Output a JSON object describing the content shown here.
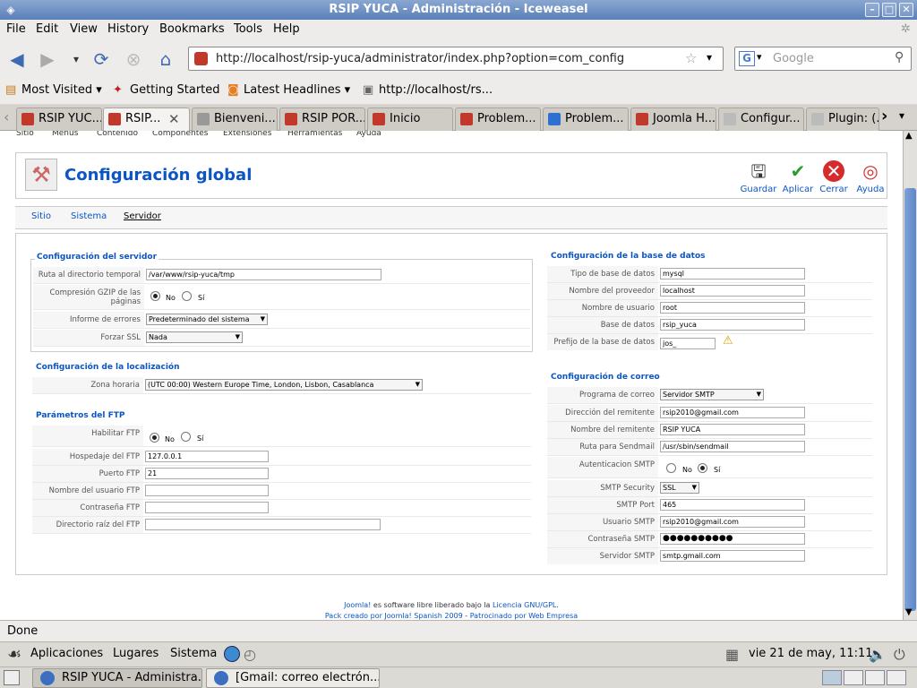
{
  "window": {
    "title": "RSIP YUCA - Administración - Iceweasel"
  },
  "menu": [
    "File",
    "Edit",
    "View",
    "History",
    "Bookmarks",
    "Tools",
    "Help"
  ],
  "nav": {
    "url": "http://localhost/rsip-yuca/administrator/index.php?option=com_config",
    "search_placeholder": "Google"
  },
  "bookmarks": [
    "Most Visited",
    "Getting Started",
    "Latest Headlines",
    "http://localhost/rs..."
  ],
  "tabs": [
    "RSIP YUC...",
    "RSIP...",
    "Bienveni...",
    "RSIP POR...",
    "Inicio",
    "Problem...",
    "Problem...",
    "Joomla H...",
    "Configur...",
    "Plugin: (..."
  ],
  "joomla": {
    "topmenu": [
      "Sitio",
      "Menús",
      "Contenido",
      "Componentes",
      "Extensiones",
      "Herramientas",
      "Ayuda"
    ],
    "page_title": "Configuración global",
    "toolbar": {
      "save": "Guardar",
      "apply": "Aplicar",
      "close": "Cerrar",
      "help": "Ayuda"
    },
    "subtabs": [
      "Sitio",
      "Sistema",
      "Servidor"
    ],
    "server": {
      "legend": "Configuración del servidor",
      "tmp_label": "Ruta al directorio temporal",
      "tmp_value": "/var/www/rsip-yuca/tmp",
      "gzip_label": "Compresión GZIP de las páginas",
      "no": "No",
      "si": "Sí",
      "errors_label": "Informe de errores",
      "errors_value": "Predeterminado del sistema",
      "ssl_label": "Forzar SSL",
      "ssl_value": "Nada"
    },
    "locale": {
      "legend": "Configuración de la localización",
      "tz_label": "Zona horaria",
      "tz_value": "(UTC 00:00) Western Europe Time, London, Lisbon, Casablanca"
    },
    "ftp": {
      "legend": "Parámetros del FTP",
      "enable_label": "Habilitar FTP",
      "host_label": "Hospedaje del FTP",
      "host_value": "127.0.0.1",
      "port_label": "Puerto FTP",
      "port_value": "21",
      "user_label": "Nombre del usuario FTP",
      "pass_label": "Contraseña FTP",
      "root_label": "Directorio raíz del FTP"
    },
    "db": {
      "legend": "Configuración de la base de datos",
      "type_label": "Tipo de base de datos",
      "type_value": "mysql",
      "host_label": "Nombre del proveedor",
      "host_value": "localhost",
      "user_label": "Nombre de usuario",
      "user_value": "root",
      "name_label": "Base de datos",
      "name_value": "rsip_yuca",
      "prefix_label": "Prefijo de la base de datos",
      "prefix_value": "jos_"
    },
    "mail": {
      "legend": "Configuración de correo",
      "mailer_label": "Programa de correo",
      "mailer_value": "Servidor SMTP",
      "from_label": "Dirección del remitente",
      "from_value": "rsip2010@gmail.com",
      "fromname_label": "Nombre del remitente",
      "fromname_value": "RSIP YUCA",
      "sendmail_label": "Ruta para Sendmail",
      "sendmail_value": "/usr/sbin/sendmail",
      "auth_label": "Autenticacion SMTP",
      "secure_label": "SMTP Security",
      "secure_value": "SSL",
      "port_label": "SMTP Port",
      "port_value": "465",
      "user_label": "Usuario SMTP",
      "user_value": "rsip2010@gmail.com",
      "pass_label": "Contraseña SMTP",
      "pass_value": "●●●●●●●●●●",
      "host_label": "Servidor SMTP",
      "host_value": "smtp.gmail.com"
    },
    "footer": {
      "joomla": "Joomla!",
      "line1_mid": " es software libre liberado bajo la ",
      "license": "Licencia GNU/GPL",
      "dot": ".",
      "line2a": "Pack creado por Joomla! Spanish 2009",
      "sep": " - ",
      "line2b": "Patrocinado por Web Empresa"
    }
  },
  "status": "Done",
  "panel": {
    "apps": "Aplicaciones",
    "places": "Lugares",
    "system": "Sistema",
    "clock": "vie 21 de may, 11:11"
  },
  "taskbar": [
    "RSIP YUCA - Administra...",
    "[Gmail: correo electrón..."
  ]
}
